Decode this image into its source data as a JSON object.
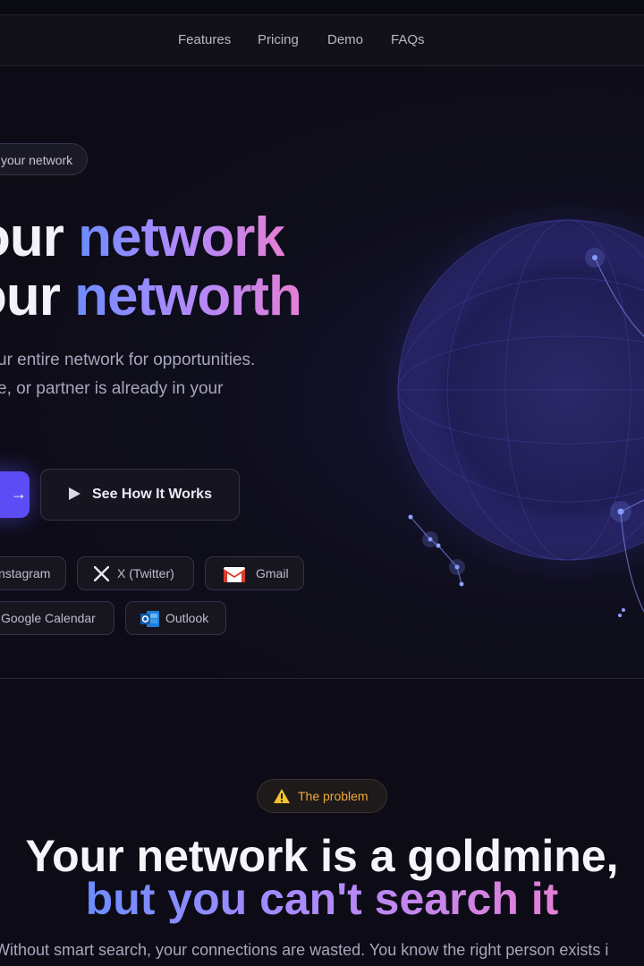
{
  "nav": {
    "links": [
      "Features",
      "Pricing",
      "Demo",
      "FAQs"
    ]
  },
  "hero": {
    "pill": "your network",
    "headline": {
      "line1_plain": "our ",
      "line1_grad": "network",
      "line2_plain": "our ",
      "line2_grad": "networth"
    },
    "subtitle": [
      "ur entire network for opportunities.",
      "e, or partner is already in your"
    ],
    "cta_primary_arrow": "→",
    "cta_secondary": "See How It Works",
    "integrations": [
      "nstagram",
      "X (Twitter)",
      "Gmail",
      "Google Calendar",
      "Outlook"
    ]
  },
  "problem": {
    "badge": "The problem",
    "title_line1": "Your network is a goldmine,",
    "title_line2": "but you can't search it",
    "body": "Without smart search, your connections are wasted. You know the right person exists i"
  },
  "colors": {
    "accent": "#5b4cf5",
    "gradient_start": "#6d8cff",
    "gradient_end": "#e37fd4",
    "warning": "#f0a93a",
    "background": "#0d0c16"
  }
}
